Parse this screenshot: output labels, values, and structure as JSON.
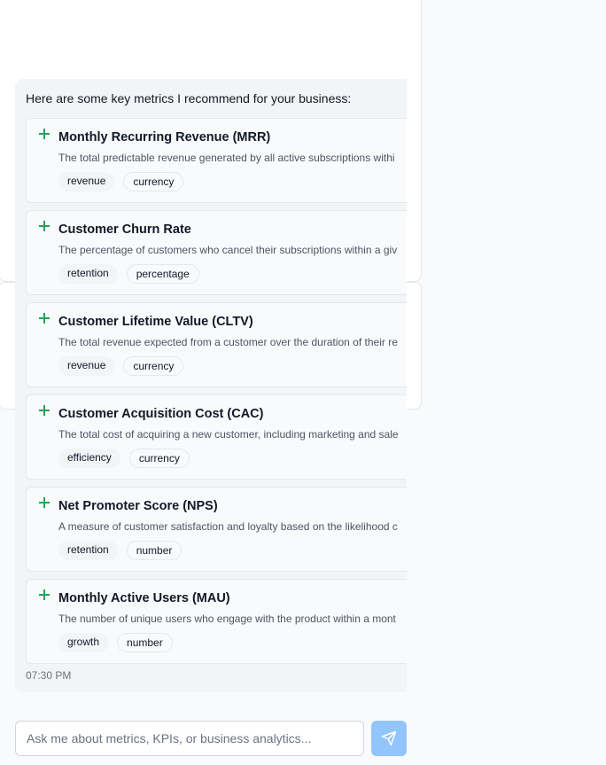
{
  "chat": {
    "intro": "Here are some key metrics I recommend for your business:",
    "timestamp": "07:30 PM",
    "metrics": [
      {
        "title": "Monthly Recurring Revenue (MRR)",
        "description": "The total predictable revenue generated by all active subscriptions withi",
        "tags": [
          "revenue",
          "currency"
        ]
      },
      {
        "title": "Customer Churn Rate",
        "description": "The percentage of customers who cancel their subscriptions within a giv",
        "tags": [
          "retention",
          "percentage"
        ]
      },
      {
        "title": "Customer Lifetime Value (CLTV)",
        "description": "The total revenue expected from a customer over the duration of their re",
        "tags": [
          "revenue",
          "currency"
        ]
      },
      {
        "title": "Customer Acquisition Cost (CAC)",
        "description": "The total cost of acquiring a new customer, including marketing and sale",
        "tags": [
          "efficiency",
          "currency"
        ]
      },
      {
        "title": "Net Promoter Score (NPS)",
        "description": "A measure of customer satisfaction and loyalty based on the likelihood c",
        "tags": [
          "retention",
          "number"
        ]
      },
      {
        "title": "Monthly Active Users (MAU)",
        "description": "The number of unique users who engage with the product within a mont",
        "tags": [
          "growth",
          "number"
        ]
      }
    ]
  },
  "input": {
    "placeholder": "Ask me about metrics, KPIs, or business analytics..."
  },
  "icons": {
    "add": "plus-icon",
    "send": "send-icon"
  },
  "colors": {
    "accent_green": "#22a35a",
    "send_button": "#93c5fd"
  }
}
